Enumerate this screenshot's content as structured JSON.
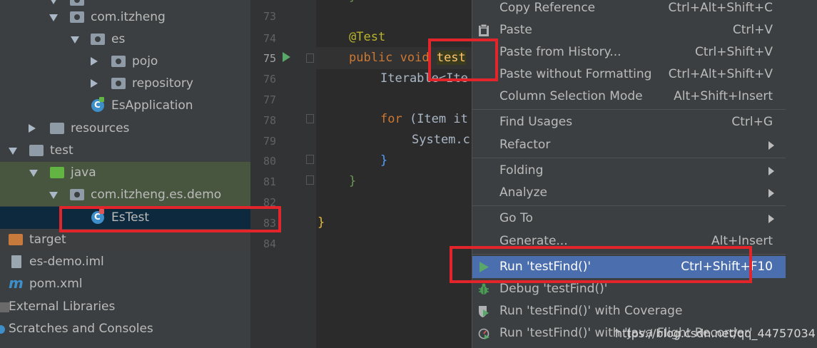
{
  "tree": {
    "items": [
      {
        "label": "com.itzheng"
      },
      {
        "label": "es"
      },
      {
        "label": "pojo"
      },
      {
        "label": "repository"
      },
      {
        "label": "EsApplication"
      },
      {
        "label": "resources"
      },
      {
        "label": "test"
      },
      {
        "label": "java"
      },
      {
        "label": "com.itzheng.es.demo"
      },
      {
        "label": "EsTest"
      },
      {
        "label": "target"
      },
      {
        "label": "es-demo.iml"
      },
      {
        "label": "pom.xml"
      },
      {
        "label": "External Libraries"
      },
      {
        "label": "Scratches and Consoles"
      }
    ],
    "maven_glyph": "m"
  },
  "gutter": {
    "line_numbers": [
      "73",
      "74",
      "75",
      "76",
      "77",
      "78",
      "79",
      "80",
      "81",
      "82",
      "83",
      "84"
    ]
  },
  "editor": {
    "l74": "@Test",
    "l75_kw": "public void ",
    "l75_name": "test",
    "l76": "Iterable<Ite",
    "l78_kw": "for ",
    "l78_rest": "(Item it",
    "l79": "System.c",
    "l80": "}",
    "l81": "}",
    "l83": "}"
  },
  "menu": {
    "copy_reference": {
      "label": "Copy Reference",
      "shortcut": "Ctrl+Alt+Shift+C"
    },
    "paste": {
      "label": "Paste",
      "shortcut": "Ctrl+V"
    },
    "paste_history": {
      "label": "Paste from History...",
      "shortcut": "Ctrl+Shift+V"
    },
    "paste_no_format": {
      "label": "Paste without Formatting",
      "shortcut": "Ctrl+Alt+Shift+V"
    },
    "column_selection": {
      "label": "Column Selection Mode",
      "shortcut": "Alt+Shift+Insert"
    },
    "find_usages": {
      "label": "Find Usages",
      "shortcut": "Ctrl+G"
    },
    "refactor": {
      "label": "Refactor"
    },
    "folding": {
      "label": "Folding"
    },
    "analyze": {
      "label": "Analyze"
    },
    "go_to": {
      "label": "Go To"
    },
    "generate": {
      "label": "Generate...",
      "shortcut": "Alt+Insert"
    },
    "run": {
      "label": "Run 'testFind()'",
      "shortcut": "Ctrl+Shift+F10"
    },
    "debug": {
      "label": "Debug 'testFind()'"
    },
    "run_coverage": {
      "label": "Run 'testFind()' with Coverage"
    },
    "run_jfr": {
      "label": "Run 'testFind()' with 'Java Flight Recorder'"
    }
  },
  "watermark": "https://blog.csdn.net/qq_44757034",
  "colors": {
    "highlight": "#4b6eaf",
    "annotation_red": "#e1252a",
    "run_green": "#59a869"
  }
}
